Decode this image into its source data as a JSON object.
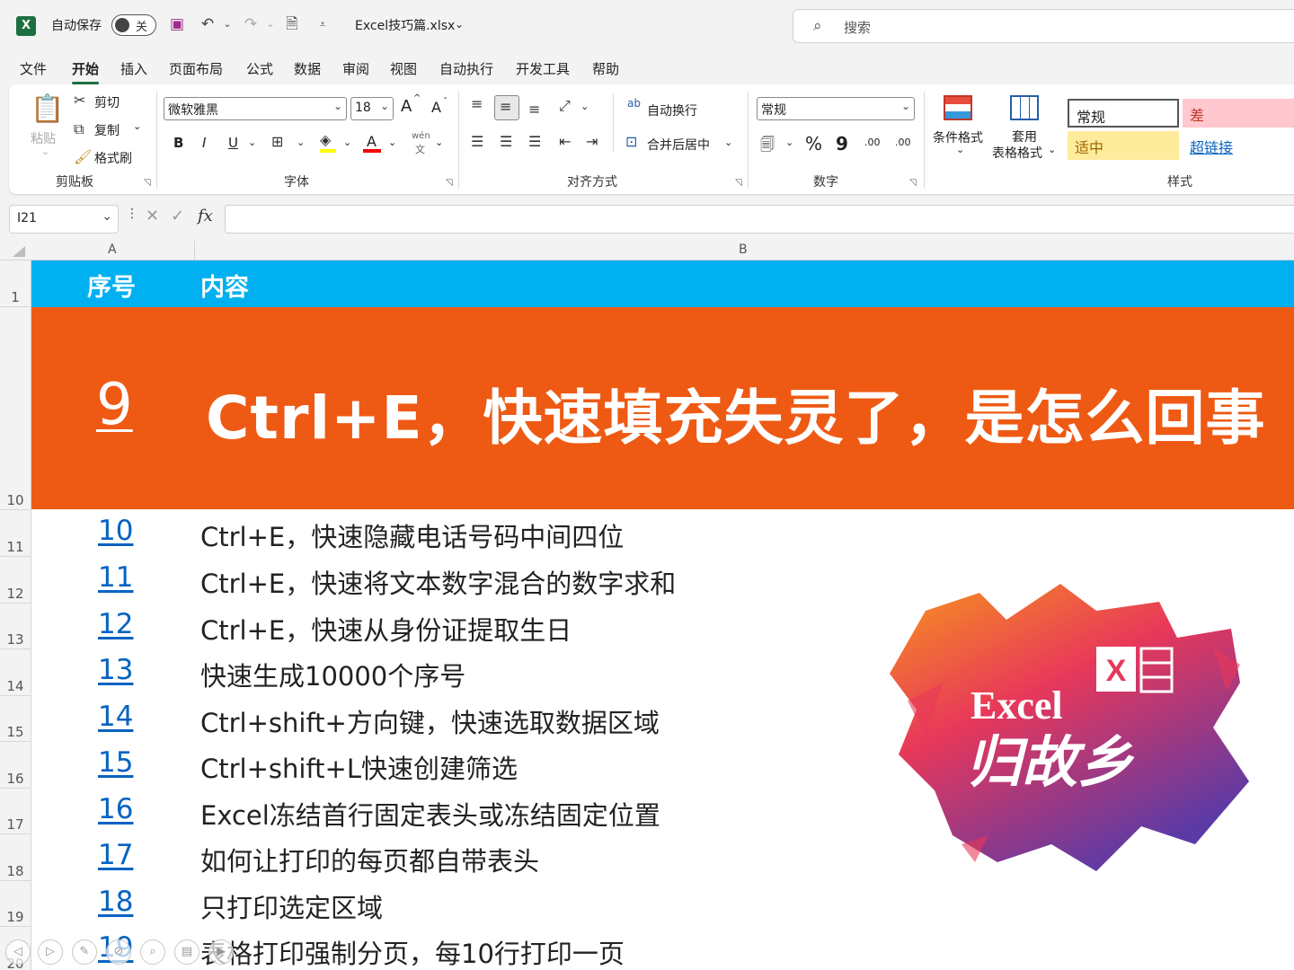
{
  "titlebar": {
    "logo": "X",
    "autosave_label": "自动保存",
    "autosave_state": "关",
    "filename": "Excel技巧篇.xlsx",
    "search_placeholder": "搜索"
  },
  "menu": [
    "文件",
    "开始",
    "插入",
    "页面布局",
    "公式",
    "数据",
    "审阅",
    "视图",
    "自动执行",
    "开发工具",
    "帮助"
  ],
  "menu_active": "开始",
  "ribbon": {
    "clipboard": {
      "paste": "粘贴",
      "cut": "剪切",
      "copy": "复制",
      "format_painter": "格式刷",
      "label": "剪贴板"
    },
    "font": {
      "name": "微软雅黑",
      "size": "18",
      "bold": "B",
      "italic": "I",
      "underline": "U",
      "label": "字体",
      "wen": "wén",
      "wen_char": "文",
      "grow": "A",
      "shrink": "A"
    },
    "alignment": {
      "wrap": "自动换行",
      "merge": "合并后居中",
      "label": "对齐方式",
      "ab": "ab"
    },
    "number": {
      "format": "常规",
      "percent": "%",
      "comma": "9",
      "label": "数字",
      "inc": ".00",
      "dec": ".00"
    },
    "styles": {
      "conditional": "条件格式",
      "table_line1": "套用",
      "table_line2": "表格格式",
      "normal": "常规",
      "bad": "差",
      "neutral": "适中",
      "hyperlink": "超链接",
      "label": "样式"
    }
  },
  "formula_bar": {
    "cell_ref": "I21",
    "fx": "fx",
    "content": ""
  },
  "columns": [
    "A",
    "B"
  ],
  "rows": [
    "1",
    "10",
    "11",
    "12",
    "13",
    "14",
    "15",
    "16",
    "17",
    "18",
    "19",
    "20"
  ],
  "sheet": {
    "header": {
      "col_a": "序号",
      "col_b": "内容"
    },
    "feature": {
      "num": "9",
      "title": "Ctrl+E，快速填充失灵了，是怎么回事"
    },
    "items": [
      {
        "num": "10",
        "text": "Ctrl+E，快速隐藏电话号码中间四位"
      },
      {
        "num": "11",
        "text": "Ctrl+E，快速将文本数字混合的数字求和"
      },
      {
        "num": "12",
        "text": "Ctrl+E，快速从身份证提取生日"
      },
      {
        "num": "13",
        "text": "快速生成10000个序号"
      },
      {
        "num": "14",
        "text": "Ctrl+shift+方向键，快速选取数据区域"
      },
      {
        "num": "15",
        "text": "Ctrl+shift+L快速创建筛选"
      },
      {
        "num": "16",
        "text": "Excel冻结首行固定表头或冻结固定位置"
      },
      {
        "num": "17",
        "text": "如何让打印的每页都自带表头"
      },
      {
        "num": "18",
        "text": "只打印选定区域"
      },
      {
        "num": "19",
        "text": "表格打印强制分页，每10行打印一页"
      }
    ]
  },
  "logo": {
    "line1": "Excel",
    "line2": "归故乡",
    "x": "X"
  },
  "colors": {
    "header_blue": "#00b0f0",
    "feature_orange": "#ee5a14",
    "link_blue": "#0563c1",
    "excel_green": "#1d6f42"
  }
}
